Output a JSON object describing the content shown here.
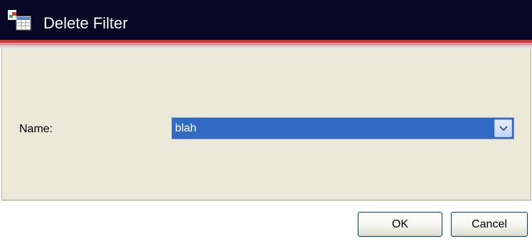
{
  "window": {
    "title": "Delete Filter",
    "icon": "filter-window-icon"
  },
  "form": {
    "name_label": "Name:",
    "name_value": "blah",
    "dropdown_icon": "chevron-down-icon"
  },
  "buttons": {
    "ok_label": "OK",
    "cancel_label": "Cancel"
  },
  "colors": {
    "titlebar_bg": "#080826",
    "accent_stripe": "#d5333b",
    "panel_bg": "#ece9d8",
    "selection_bg": "#316ac5"
  }
}
